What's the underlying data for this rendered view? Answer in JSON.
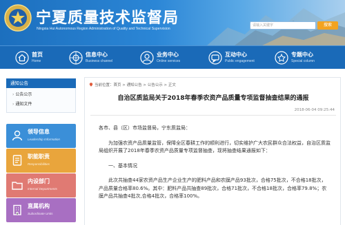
{
  "header": {
    "title": "宁夏质量技术监督局",
    "subtitle": "Ningxia Hui Autonomous Region Administration of Quality and Technical Supervision",
    "search_placeholder": "请输入关键字",
    "search_label": "搜索"
  },
  "nav": [
    {
      "label": "首页",
      "sub": "Home",
      "icon": "home-icon"
    },
    {
      "label": "信息中心",
      "sub": "Business channel",
      "icon": "info-icon"
    },
    {
      "label": "业务中心",
      "sub": "Online services",
      "icon": "service-icon"
    },
    {
      "label": "互动中心",
      "sub": "Public engagement",
      "icon": "interact-icon"
    },
    {
      "label": "专题中心",
      "sub": "Special column",
      "icon": "topic-icon"
    }
  ],
  "sidebar": {
    "heading": "通知公告",
    "items": [
      "公告公示",
      "通知文件"
    ]
  },
  "tiles": [
    {
      "label": "领导信息",
      "sub": "Leadership Information",
      "color": "#3b8fd8"
    },
    {
      "label": "职能职责",
      "sub": "Responsibilities",
      "color": "#e9a53c"
    },
    {
      "label": "内设部门",
      "sub": "Internal Departments",
      "color": "#e07a73"
    },
    {
      "label": "直属机构",
      "sub": "Subordinate Units",
      "color": "#a86fc2"
    }
  ],
  "breadcrumb": "当前位置：首页 > 通知公告 > 公告公示 > 正文",
  "article": {
    "title": "自治区质监局关于2018年春季农资产品质量专项监督抽查结果的通报",
    "date": "2018-06-04 09:25:44",
    "greeting": "各市、县（区）市场监督局，宁东质监局：",
    "para1": "为加强农资产品质量监管，保障全区春耕工作的顺利进行，切实维护广大农民群众合法权益，自治区质监局组织开展了2018年春季农资产品质量专项监督抽查，现将抽查结果通报如下：",
    "section1": "一、基本情况",
    "para2": "此次共抽查44家农资产品生产企业生产的肥料产品和农膜产品93批次，合格75批次，不合格18批次，产品质量合格率80.6%。其中：肥料产品共抽查89批次，合格71批次，不合格18批次，合格率79.8%；农膜产品共抽查4批次,合格4批次，合格率100%。"
  },
  "colors": {
    "brand_blue": "#1a6ab8",
    "accent_orange": "#f3a321"
  }
}
